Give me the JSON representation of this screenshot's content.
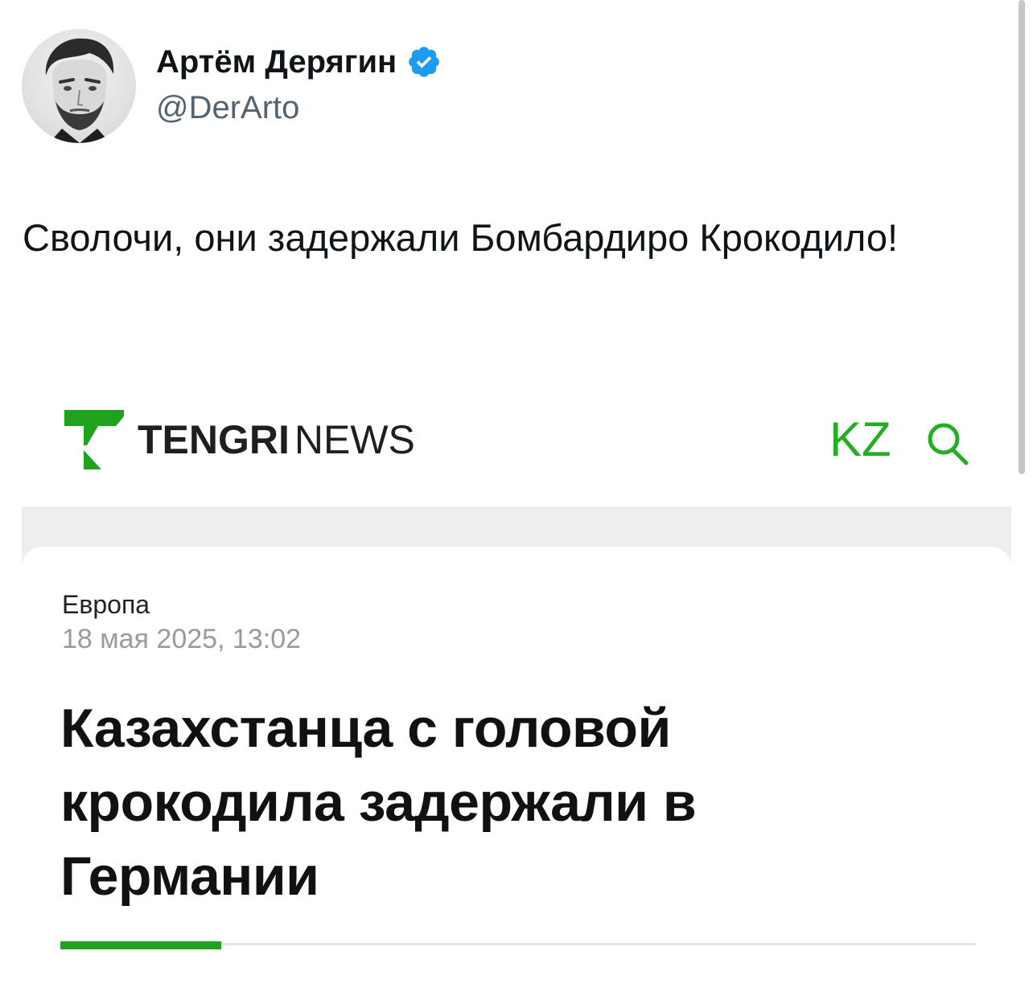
{
  "tweet": {
    "author": {
      "name": "Артём Дерягин",
      "handle": "@DerArto",
      "verified": true,
      "verified_color": "#1d9bf0"
    },
    "text": "Сволочи, они задержали Бомбардиро Крокодило!"
  },
  "embedded_screenshot": {
    "site": {
      "logo_bold": "TENGRI",
      "logo_light": "NEWS",
      "brand_color": "#22b022",
      "lang_label": "KZ",
      "search_icon": "search-icon"
    },
    "article": {
      "category": "Европа",
      "date": "18 мая 2025, 13:02",
      "title": "Казахстанца с головой крокодила задержали в Германии",
      "read_progress": 0.176
    }
  }
}
